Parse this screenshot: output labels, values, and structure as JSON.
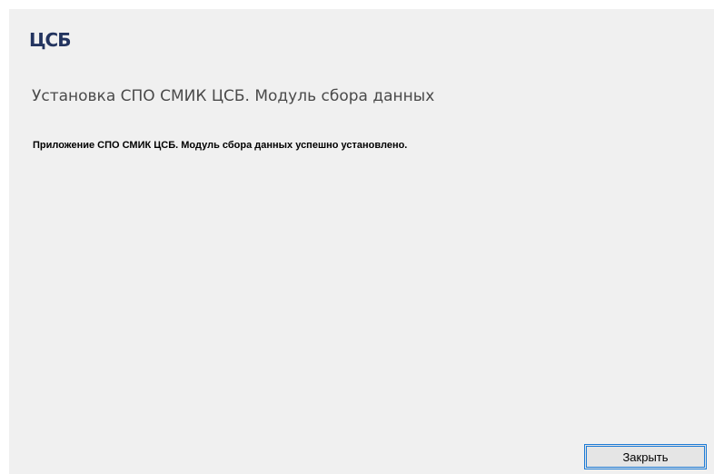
{
  "app": {
    "logo_text": "ЦСБ",
    "title": "Установка СПО СМИК ЦСБ. Модуль сбора данных",
    "message": "Приложение СПО СМИК ЦСБ. Модуль сбора данных успешно установлено."
  },
  "buttons": {
    "close_label": "Закрыть"
  },
  "colors": {
    "logo": "#23345f",
    "accent": "#1e7cd6",
    "window_bg": "#f0f0f0"
  }
}
